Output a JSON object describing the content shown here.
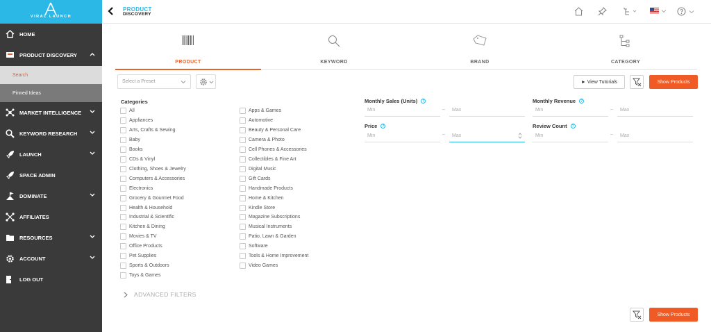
{
  "logo": {
    "text": "VIRAL LAUNCH"
  },
  "sidebar": {
    "items": [
      {
        "label": "HOME",
        "icon": "home-icon"
      },
      {
        "label": "PRODUCT DISCOVERY",
        "icon": "cart-icon"
      },
      {
        "label": "MARKET INTELLIGENCE",
        "icon": "network-icon"
      },
      {
        "label": "KEYWORD RESEARCH",
        "icon": "search-icon"
      },
      {
        "label": "LAUNCH",
        "icon": "rocket-icon"
      },
      {
        "label": "SPACE ADMIN",
        "icon": "rocket-icon"
      },
      {
        "label": "DOMINATE",
        "icon": "flag-icon"
      },
      {
        "label": "AFFILIATES",
        "icon": "share-icon"
      },
      {
        "label": "RESOURCES",
        "icon": "folder-icon"
      },
      {
        "label": "ACCOUNT",
        "icon": "gear-icon"
      },
      {
        "label": "LOG OUT",
        "icon": "logout-icon"
      }
    ],
    "sub_items": [
      "Search",
      "Pinned Ideas"
    ]
  },
  "header": {
    "title_line1": "PRODUCT",
    "title_line2": "DISCOVERY"
  },
  "tabs": [
    {
      "label": "PRODUCT",
      "icon": "barcode-icon"
    },
    {
      "label": "KEYWORD",
      "icon": "magnifier-icon"
    },
    {
      "label": "BRAND",
      "icon": "tag-icon"
    },
    {
      "label": "CATEGORY",
      "icon": "hierarchy-icon"
    }
  ],
  "toolbar": {
    "preset_placeholder": "Select a Preset",
    "view_tutorials": "► View Tutorials",
    "show_products": "Show Products"
  },
  "categories": {
    "heading": "Categories",
    "left": [
      "All",
      "Appliances",
      "Arts, Crafts & Sewing",
      "Baby",
      "Books",
      "CDs & Vinyl",
      "Clothing, Shoes & Jewelry",
      "Computers & Accessories",
      "Electronics",
      "Grocery & Gourmet Food",
      "Health & Household",
      "Industrial & Scientific",
      "Kitchen & Dining",
      "Movies & TV",
      "Office Products",
      "Pet Supplies",
      "Sports & Outdoors",
      "Toys & Games"
    ],
    "right": [
      "Apps & Games",
      "Automotive",
      "Beauty & Personal Care",
      "Camera & Photo",
      "Cell Phones & Accessories",
      "Collectibles & Fine Art",
      "Digital Music",
      "Gift Cards",
      "Handmade Products",
      "Home & Kitchen",
      "Kindle Store",
      "Magazine Subscriptions",
      "Musical Instruments",
      "Patio, Lawn & Garden",
      "Software",
      "Tools & Home Improvement",
      "Video Games"
    ]
  },
  "ranges": {
    "monthly_sales": "Monthly Sales (Units)",
    "monthly_revenue": "Monthly Revenue",
    "price": "Price",
    "review_count": "Review Count",
    "min": "Min",
    "max": "Max",
    "dash": "–"
  },
  "advanced_filters": "ADVANCED FILTERS",
  "colors": {
    "accent": "#f05a24",
    "brand": "#2bb8e6",
    "sidebar": "#3a3a3a"
  }
}
